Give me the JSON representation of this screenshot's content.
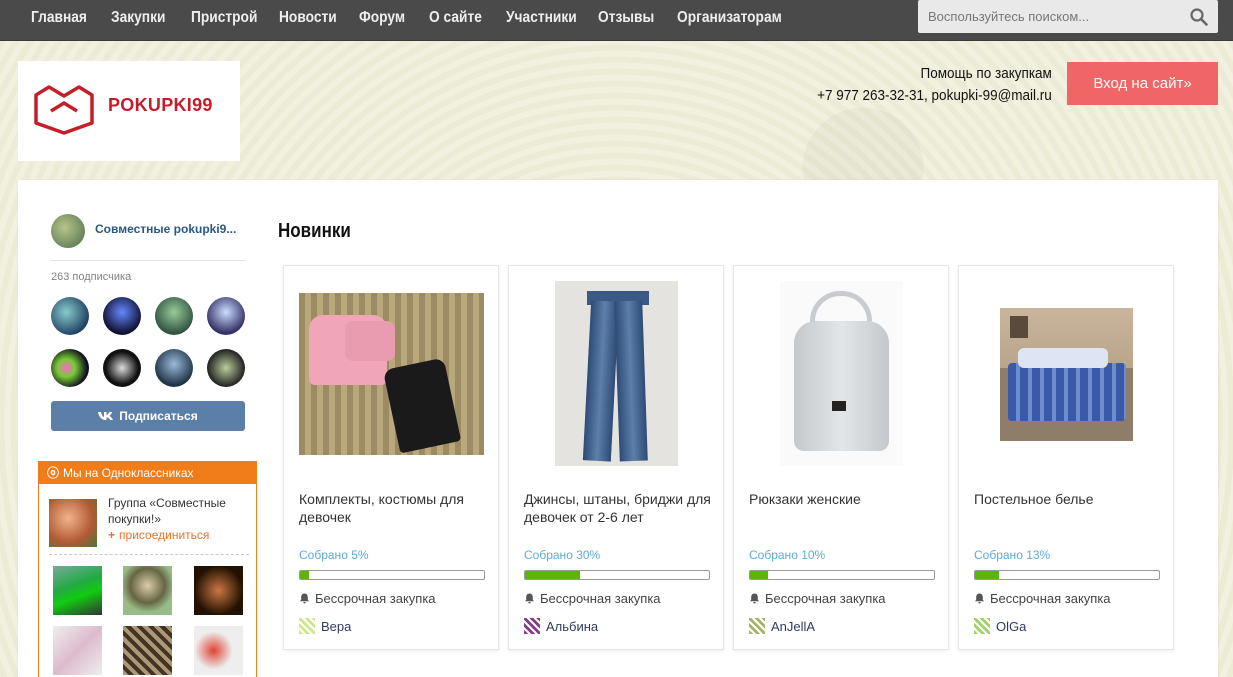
{
  "nav": {
    "items": [
      "Главная",
      "Закупки",
      "Пристрой",
      "Новости",
      "Форум",
      "О сайте",
      "Участники",
      "Отзывы",
      "Организаторам"
    ],
    "search_placeholder": "Воспользуйтесь поиском..."
  },
  "header": {
    "logo_text": "POKUPKI99",
    "help_title": "Помощь по закупкам",
    "help_contacts": "+7 977 263-32-31, pokupki-99@mail.ru",
    "login_label": "Вход на сайт»"
  },
  "vk_widget": {
    "group_name": "Совместные pokupki9...",
    "subscribers": "263 подписчика",
    "subscribe_label": "Подписаться"
  },
  "ok_widget": {
    "header": "Мы на Одноклассниках",
    "group_title": "Группа «Совместные покупки!»",
    "join_label": "присоединиться"
  },
  "section_title": "Новинки",
  "products": [
    {
      "title": "Комплекты, костюмы для девочек",
      "collected": "Собрано 5%",
      "progress": 0.05,
      "type": "Бессрочная закупка",
      "organizer": "Вера"
    },
    {
      "title": "Джинсы, штаны, бриджи для девочек от 2-6 лет",
      "collected": "Собрано 30%",
      "progress": 0.3,
      "type": "Бессрочная закупка",
      "organizer": "Альбина"
    },
    {
      "title": "Рюкзаки женские",
      "collected": "Собрано 10%",
      "progress": 0.1,
      "type": "Бессрочная закупка",
      "organizer": "AnJellA"
    },
    {
      "title": "Постельное белье",
      "collected": "Собрано 13%",
      "progress": 0.13,
      "type": "Бессрочная закупка",
      "organizer": "OlGa"
    }
  ],
  "colors": {
    "nav_bg": "#4a4a4a",
    "login_btn": "#f06666",
    "vk_btn": "#5b7fa8",
    "ok_orange": "#f07d1a",
    "progress": "#5cb500",
    "link": "#5fa9d8"
  }
}
